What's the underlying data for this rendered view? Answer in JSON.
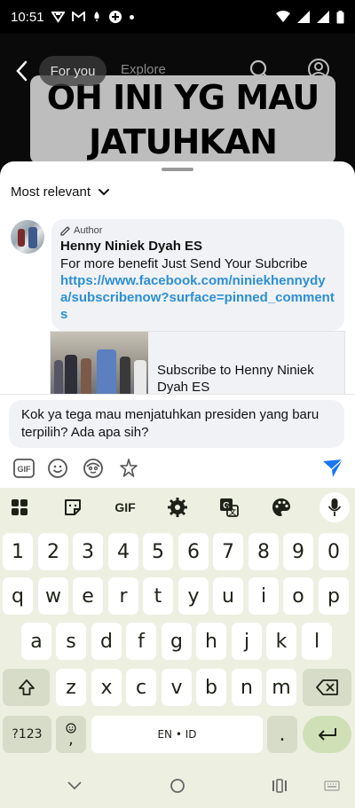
{
  "status_bar": {
    "time": "10:51"
  },
  "video": {
    "caption_line1": "OH INI YG MAU",
    "caption_line2": "JATUHKAN",
    "tabs": [
      "For you",
      "Explore"
    ]
  },
  "comments_sheet": {
    "sort_label": "Most relevant",
    "pinned_comment": {
      "author_tag": "Author",
      "author_name": "Henny Niniek Dyah ES",
      "text": "For more benefit Just Send Your Subcribe",
      "link": "https://www.facebook.com/niniekhennydya/subscribenow?surface=pinned_comments"
    },
    "link_card": {
      "title": "Subscribe to Henny Niniek Dyah ES"
    }
  },
  "composer": {
    "input_value": "Kok ya tega mau menjatuhkan presiden yang baru terpilih? Ada apa sih?",
    "icons": [
      "gif-icon",
      "emoji-icon",
      "avatar-sticker-icon",
      "sparkle-sticker-icon",
      "send-icon"
    ],
    "accent_color": "#1877f2"
  },
  "keyboard": {
    "toolbar_gif": "GIF",
    "row1": [
      "1",
      "2",
      "3",
      "4",
      "5",
      "6",
      "7",
      "8",
      "9",
      "0"
    ],
    "row2": [
      "q",
      "w",
      "e",
      "r",
      "t",
      "y",
      "u",
      "i",
      "o",
      "p"
    ],
    "row3": [
      "a",
      "s",
      "d",
      "f",
      "g",
      "h",
      "j",
      "k",
      "l"
    ],
    "row4": [
      "z",
      "x",
      "c",
      "v",
      "b",
      "n",
      "m"
    ],
    "symbols_label": "?123",
    "comma_label": ",",
    "space_label": "EN • ID",
    "period_label": "."
  }
}
